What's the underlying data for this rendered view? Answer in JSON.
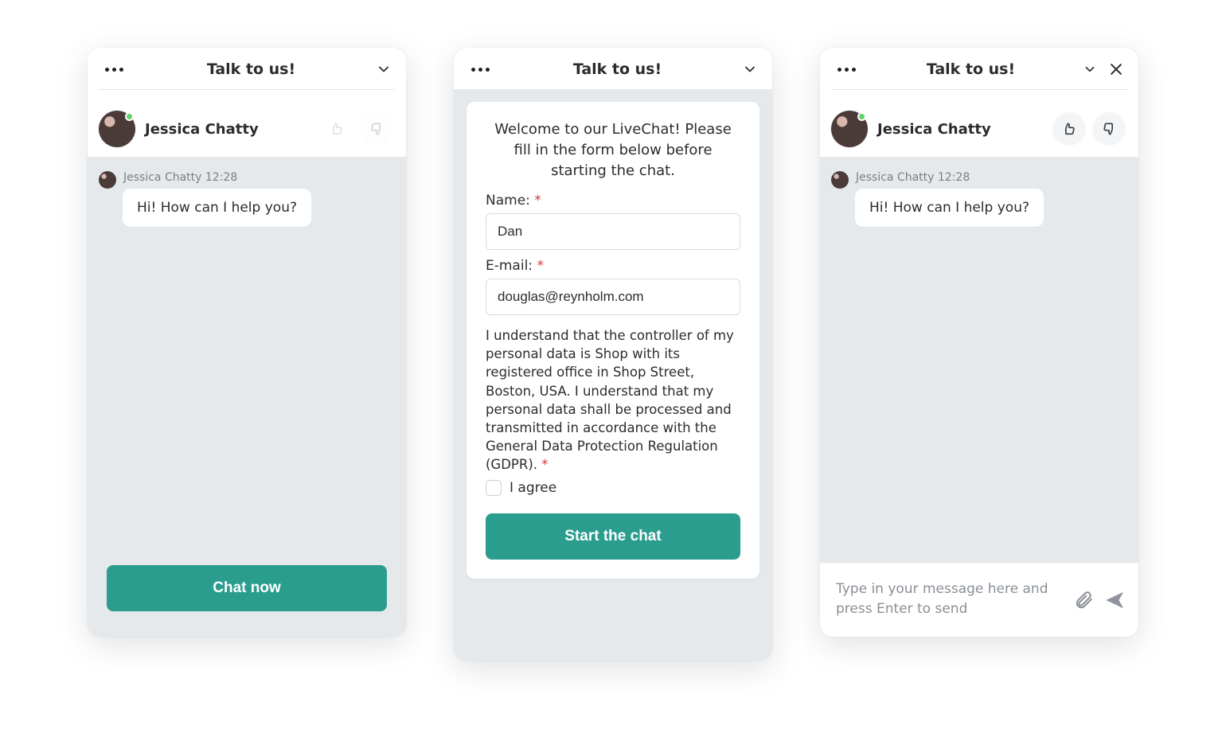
{
  "header": {
    "title": "Talk to us!"
  },
  "agent": {
    "name": "Jessica Chatty"
  },
  "message": {
    "meta": "Jessica Chatty 12:28",
    "text": "Hi! How can I help you?"
  },
  "cta": {
    "chat_now": "Chat now"
  },
  "form": {
    "intro": "Welcome to our LiveChat! Please fill in the form below before starting the chat.",
    "name_label": "Name:",
    "name_value": "Dan",
    "email_label": "E-mail:",
    "email_value": "douglas@reynholm.com",
    "legal": "I understand that the controller of my personal data is Shop with its registered office in Shop Street, Boston, USA. I understand that my personal data shall be processed and transmitted in accordance with the General Data Protection Regulation (GDPR).",
    "agree_label": "I agree",
    "start_label": "Start the chat"
  },
  "composer": {
    "placeholder": "Type in your message here and press Enter to send"
  },
  "required_mark": "*"
}
